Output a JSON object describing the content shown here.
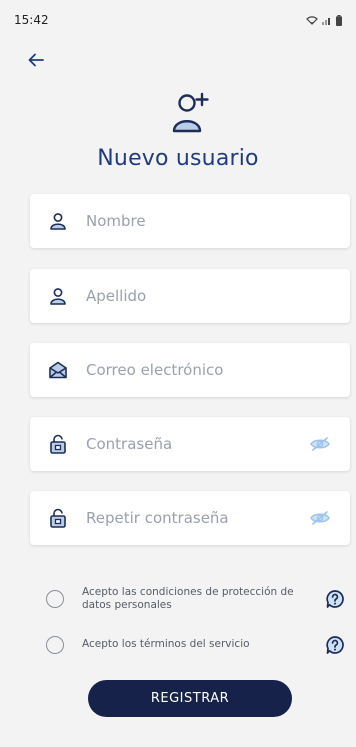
{
  "status_bar": {
    "time": "15:42",
    "icons": [
      "wifi-icon",
      "signal-icon",
      "battery-icon"
    ]
  },
  "header": {
    "back_icon": "arrow-left-icon",
    "hero_icon": "add-user-icon",
    "title": "Nuevo usuario"
  },
  "form": {
    "fields": [
      {
        "name": "first-name",
        "icon": "user-icon",
        "placeholder": "Nombre"
      },
      {
        "name": "last-name",
        "icon": "user-icon",
        "placeholder": "Apellido"
      },
      {
        "name": "email",
        "icon": "envelope-icon",
        "placeholder": "Correo electrónico"
      },
      {
        "name": "password",
        "icon": "lock-icon",
        "placeholder": "Contraseña",
        "toggle_icon": "eye-off-icon"
      },
      {
        "name": "repeat-password",
        "icon": "lock-icon",
        "placeholder": "Repetir contraseña",
        "toggle_icon": "eye-off-icon"
      }
    ],
    "consents": [
      {
        "text": "Acepto las condiciones de protección de datos personales",
        "checked": false,
        "help_icon": "help-icon"
      },
      {
        "text": "Acepto los términos del servicio",
        "checked": false,
        "help_icon": "help-icon"
      }
    ],
    "submit_label": "REGISTRAR"
  },
  "colors": {
    "accent": "#1f3c7d",
    "button": "#16224a",
    "background": "#f3f3f3",
    "placeholder": "#9aa1ad",
    "eye_icon": "#9ec3ea"
  }
}
